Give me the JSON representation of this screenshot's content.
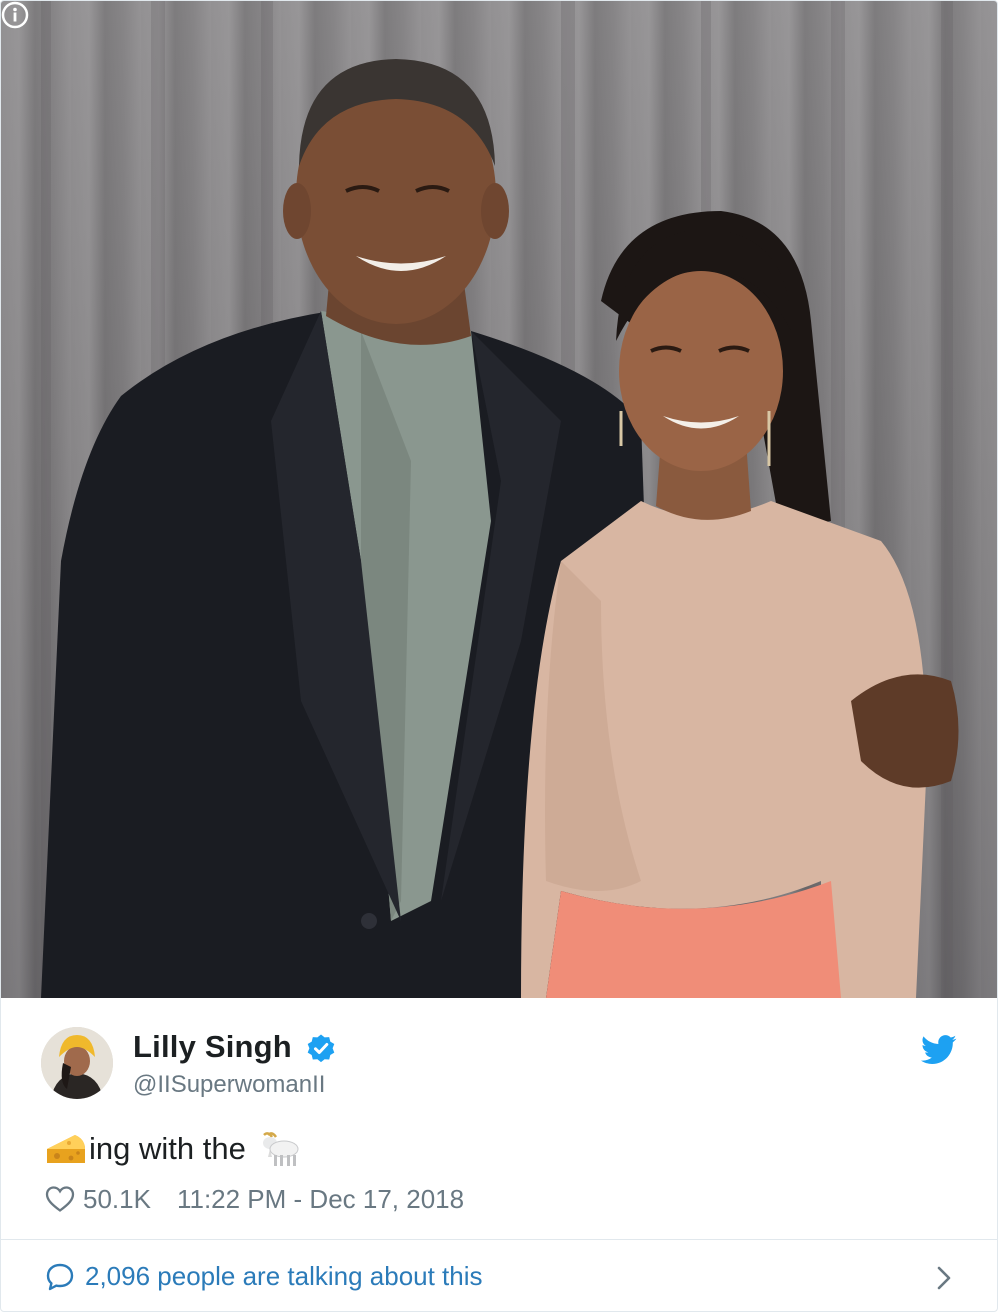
{
  "tweet": {
    "author_name": "Lilly Singh",
    "author_handle": "@IISuperwomanII",
    "text_part": "ing with the",
    "text_emoji_prefix": "cheese-emoji",
    "text_emoji_suffix": "goat-emoji",
    "likes": "50.1K",
    "timestamp": "11:22 PM - Dec 17, 2018",
    "verified": true
  },
  "footer": {
    "talking_text": "2,096 people are talking about this"
  },
  "icons": {
    "info": "info-icon",
    "verified": "verified-badge-icon",
    "brand": "twitter-bird-icon",
    "like": "heart-icon",
    "reply": "speech-bubble-icon",
    "more": "chevron-right-icon"
  },
  "colors": {
    "twitter_blue": "#1da1f2",
    "link_blue": "#2b7bb9",
    "muted_gray": "#697882",
    "text_dark": "#1c2022",
    "border": "#e1e8ed"
  }
}
